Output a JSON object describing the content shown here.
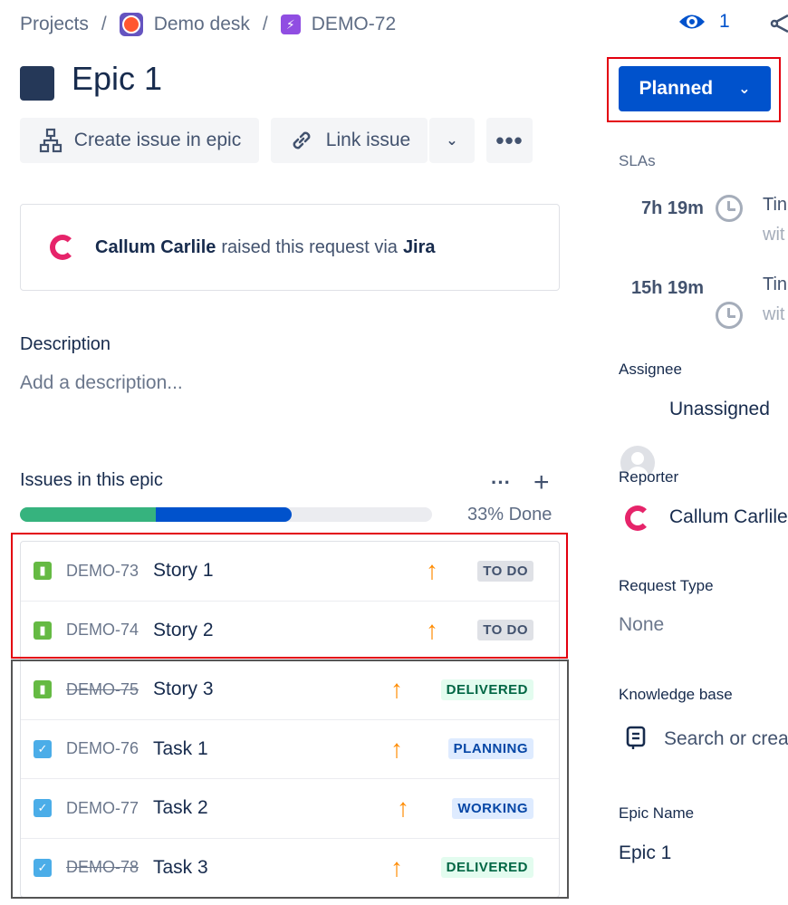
{
  "breadcrumb": {
    "projects": "Projects",
    "sep": "/",
    "project": "Demo desk",
    "issue_key": "DEMO-72"
  },
  "header": {
    "watch_count": "1"
  },
  "issue": {
    "title": "Epic 1"
  },
  "actions": {
    "create_issue": "Create issue in epic",
    "link_issue": "Link issue"
  },
  "reporter_card": {
    "name": "Callum Carlile",
    "text": "raised this request via",
    "channel": "Jira"
  },
  "description": {
    "heading": "Description",
    "placeholder": "Add a description..."
  },
  "epic_issues": {
    "heading": "Issues in this epic",
    "progress": {
      "done_fraction": 0.33,
      "in_progress_fraction": 0.33,
      "label": "33% Done"
    },
    "rows": [
      {
        "type": "story",
        "key": "DEMO-73",
        "summary": "Story 1",
        "priority": "high",
        "status": "TO DO",
        "done": false
      },
      {
        "type": "story",
        "key": "DEMO-74",
        "summary": "Story 2",
        "priority": "high",
        "status": "TO DO",
        "done": false
      },
      {
        "type": "story",
        "key": "DEMO-75",
        "summary": "Story 3",
        "priority": "high",
        "status": "DELIVERED",
        "done": true
      },
      {
        "type": "task",
        "key": "DEMO-76",
        "summary": "Task 1",
        "priority": "high",
        "status": "PLANNING",
        "done": false
      },
      {
        "type": "task",
        "key": "DEMO-77",
        "summary": "Task 2",
        "priority": "high",
        "status": "WORKING",
        "done": false
      },
      {
        "type": "task",
        "key": "DEMO-78",
        "summary": "Task 3",
        "priority": "high",
        "status": "DELIVERED",
        "done": true
      }
    ]
  },
  "sidebar": {
    "status": "Planned",
    "slas_label": "SLAs",
    "slas": [
      {
        "time": "7h 19m",
        "text": "Tin",
        "sub": "wit"
      },
      {
        "time": "15h 19m",
        "text": "Tin",
        "sub": "wit"
      }
    ],
    "assignee_label": "Assignee",
    "assignee": "Unassigned",
    "reporter_label": "Reporter",
    "reporter": "Callum Carlile",
    "request_type_label": "Request Type",
    "request_type": "None",
    "kb_label": "Knowledge base",
    "kb_placeholder": "Search or crea",
    "epic_name_label": "Epic Name",
    "epic_name": "Epic 1"
  },
  "colors": {
    "progress_done": "#36B37E",
    "progress_in_progress": "#0052CC",
    "status_button": "#0052CC",
    "highlight": "#E3000F"
  }
}
